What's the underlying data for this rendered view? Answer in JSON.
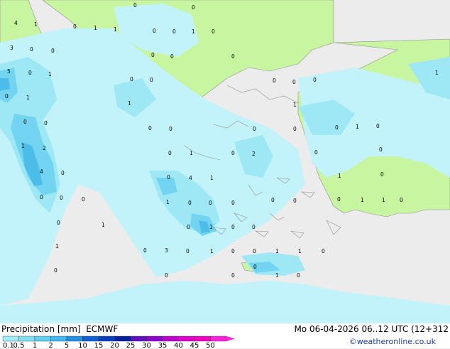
{
  "title": "Precipitation [mm]",
  "model": "ECMWF",
  "valid_time": "Mo 06-04-2026 06..12 UTC (12+312",
  "credit": "©weatheronline.co.uk",
  "legend": {
    "ticks": [
      "0.1",
      "0.5",
      "1",
      "2",
      "5",
      "10",
      "15",
      "20",
      "25",
      "30",
      "35",
      "40",
      "45",
      "50"
    ],
    "colors": [
      "#a0eef8",
      "#80e0f0",
      "#60d0f0",
      "#40b8f0",
      "#2090e8",
      "#1060d8",
      "#0840c0",
      "#0020a0",
      "#6010c0",
      "#9000d0",
      "#c000d0",
      "#e000d0",
      "#f000c0",
      "#ff20e0"
    ]
  },
  "colors": {
    "sea_no_precip": "#ececec",
    "land": "#c8f5a0",
    "precip_light": "#c2f2fa",
    "precip_medium": "#9ee8f6",
    "precip_heavy": "#72d4f0",
    "precip_strong": "#4cbce8",
    "coast": "#909090"
  },
  "grid_values": [
    {
      "v": "4"
    },
    {
      "v": "1"
    },
    {
      "v": "0"
    },
    {
      "v": "0"
    },
    {
      "v": "1"
    },
    {
      "v": "1"
    },
    {
      "v": "0"
    },
    {
      "v": "0"
    },
    {
      "v": "0"
    },
    {
      "v": "3"
    },
    {
      "v": "0"
    },
    {
      "v": "0"
    },
    {
      "v": "0"
    },
    {
      "v": "0"
    },
    {
      "v": "0"
    },
    {
      "v": "1"
    },
    {
      "v": "0"
    },
    {
      "v": "0"
    },
    {
      "v": "5"
    },
    {
      "v": "0"
    },
    {
      "v": "1"
    },
    {
      "v": "0"
    },
    {
      "v": "0"
    },
    {
      "v": "0"
    },
    {
      "v": "0"
    },
    {
      "v": "1"
    },
    {
      "v": "2"
    },
    {
      "v": "1"
    },
    {
      "v": "1"
    },
    {
      "v": "0"
    },
    {
      "v": "0"
    },
    {
      "v": "0"
    },
    {
      "v": "4"
    },
    {
      "v": "0"
    },
    {
      "v": "1"
    },
    {
      "v": "0"
    },
    {
      "v": "0"
    },
    {
      "v": "0"
    },
    {
      "v": "0"
    },
    {
      "v": "0"
    },
    {
      "v": "0"
    },
    {
      "v": "1"
    },
    {
      "v": "0"
    },
    {
      "v": "2"
    },
    {
      "v": "1"
    },
    {
      "v": "0"
    },
    {
      "v": "1"
    },
    {
      "v": "0"
    },
    {
      "v": "1"
    },
    {
      "v": "0"
    },
    {
      "v": "4"
    },
    {
      "v": "0"
    },
    {
      "v": "1"
    },
    {
      "v": "0"
    },
    {
      "v": "0"
    },
    {
      "v": "1"
    },
    {
      "v": "1"
    },
    {
      "v": "0"
    },
    {
      "v": "1"
    },
    {
      "v": "0"
    },
    {
      "v": "0"
    },
    {
      "v": "0"
    },
    {
      "v": "0"
    },
    {
      "v": "1"
    },
    {
      "v": "0"
    },
    {
      "v": "1"
    },
    {
      "v": "0"
    },
    {
      "v": "1"
    },
    {
      "v": "0"
    },
    {
      "v": "0"
    },
    {
      "v": "3"
    },
    {
      "v": "0"
    },
    {
      "v": "1"
    },
    {
      "v": "0"
    },
    {
      "v": "0"
    },
    {
      "v": "1"
    },
    {
      "v": "1"
    },
    {
      "v": "0"
    },
    {
      "v": "0"
    },
    {
      "v": "0"
    },
    {
      "v": "0"
    },
    {
      "v": "1"
    },
    {
      "v": "0"
    },
    {
      "v": "0"
    },
    {
      "v": "0"
    },
    {
      "v": "0"
    },
    {
      "v": "0"
    },
    {
      "v": "0"
    },
    {
      "v": "0"
    }
  ]
}
